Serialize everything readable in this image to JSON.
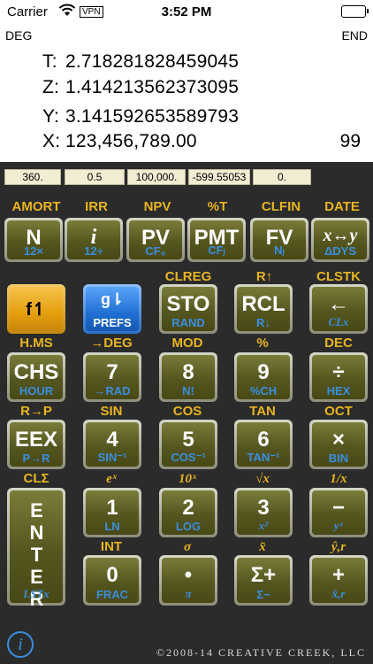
{
  "status": {
    "carrier": "Carrier",
    "vpn": "VPN",
    "time": "3:52 PM"
  },
  "display": {
    "angle_mode": "DEG",
    "payment_mode": "END",
    "T_label": "T:",
    "T": "2.718281828459045",
    "Z_label": "Z:",
    "Z": "1.414213562373095",
    "Y_label": "Y:",
    "Y": "3.141592653589793",
    "X_label": "X:",
    "X": "123,456,789.00",
    "count": "99"
  },
  "registers": [
    "360.",
    "0.5",
    "100,000.",
    "-599.55053",
    "0."
  ],
  "rows": [
    {
      "top": [
        "AMORT",
        "IRR",
        "NPV",
        "%T",
        "CLFIN",
        "DATE"
      ],
      "keys": [
        {
          "main": "N",
          "sub": "12×"
        },
        {
          "main": "i",
          "sub": "12÷"
        },
        {
          "main": "PV",
          "sub": "CF₀"
        },
        {
          "main": "PMT",
          "sub": "CFⱼ"
        },
        {
          "main": "FV",
          "sub": "Nⱼ"
        },
        {
          "main": "x↔y",
          "sub": "ΔDYS"
        }
      ]
    },
    {
      "top": [
        "",
        "",
        "CLREG",
        "R↑",
        "CLSTK"
      ],
      "keys": [
        {
          "main": "f↿",
          "sub": ""
        },
        {
          "main": "g⇂",
          "sub": "PREFS"
        },
        {
          "main": "STO",
          "sub": "RAND"
        },
        {
          "main": "RCL",
          "sub": "R↓"
        },
        {
          "main": "←",
          "sub": "CLx"
        }
      ]
    },
    {
      "top": [
        "H.MS",
        "→DEG",
        "MOD",
        "%",
        "DEC"
      ],
      "keys": [
        {
          "main": "CHS",
          "sub": "HOUR"
        },
        {
          "main": "7",
          "sub": "→RAD"
        },
        {
          "main": "8",
          "sub": "N!"
        },
        {
          "main": "9",
          "sub": "%CH"
        },
        {
          "main": "÷",
          "sub": "HEX"
        }
      ]
    },
    {
      "top": [
        "R→P",
        "SIN",
        "COS",
        "TAN",
        "OCT"
      ],
      "keys": [
        {
          "main": "EEX",
          "sub": "P→R"
        },
        {
          "main": "4",
          "sub": "SIN⁻¹"
        },
        {
          "main": "5",
          "sub": "COS⁻¹"
        },
        {
          "main": "6",
          "sub": "TAN⁻¹"
        },
        {
          "main": "×",
          "sub": "BIN"
        }
      ]
    },
    {
      "top": [
        "CLΣ",
        "eˣ",
        "10ˣ",
        "√x",
        "1/x"
      ],
      "keys": [
        {
          "main": "1",
          "sub": "LN"
        },
        {
          "main": "2",
          "sub": "LOG"
        },
        {
          "main": "3",
          "sub": "x²"
        },
        {
          "main": "−",
          "sub": "yˣ"
        }
      ]
    },
    {
      "top": [
        "INT",
        "σ",
        "x̄",
        "ŷ,r"
      ],
      "keys": [
        {
          "main": "0",
          "sub": "FRAC"
        },
        {
          "main": "•",
          "sub": "π"
        },
        {
          "main": "Σ+",
          "sub": "Σ−"
        },
        {
          "main": "+",
          "sub": "x̂,r"
        }
      ]
    }
  ],
  "enter": {
    "main": "ENTER",
    "sub": "LSTx"
  },
  "info": "i",
  "copyright": "©2008-14 CREATIVE CREEK, LLC"
}
